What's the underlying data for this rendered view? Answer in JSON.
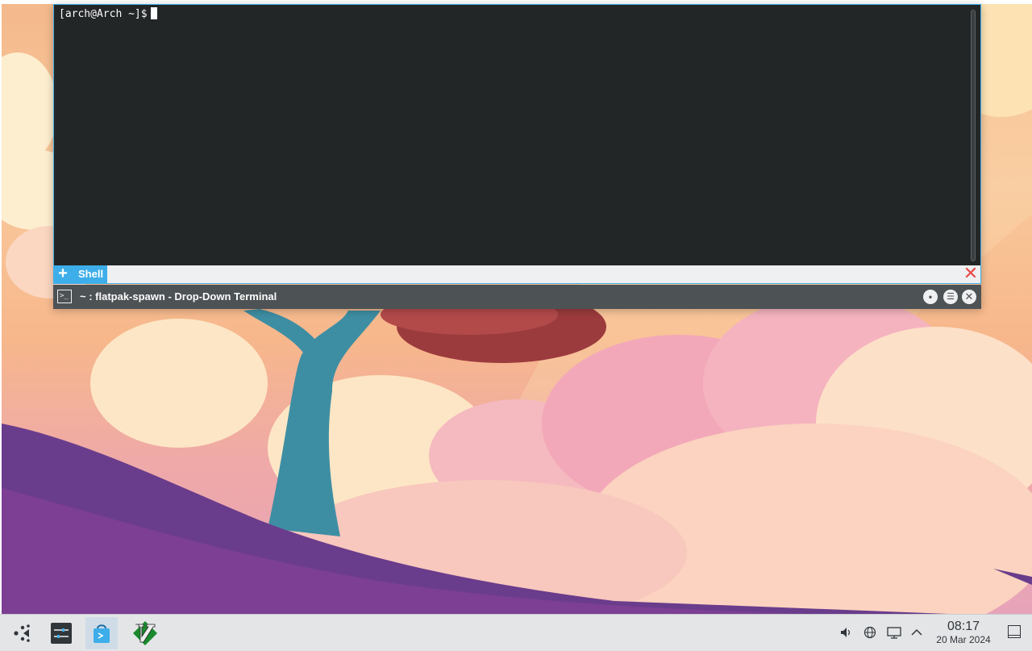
{
  "terminal": {
    "prompt": "[arch@Arch ~]$",
    "tabs": [
      {
        "label": "Shell"
      }
    ],
    "new_tab_glyph": "+",
    "close_glyph": "✕",
    "window_title": "~ : flatpak-spawn - Drop-Down Terminal",
    "title_icon_glyph": ">_"
  },
  "taskbar": {
    "launchers": [
      {
        "name": "application-launcher-icon"
      },
      {
        "name": "system-settings-icon"
      },
      {
        "name": "store-icon",
        "active": true
      },
      {
        "name": "vim-icon"
      }
    ],
    "tray": [
      {
        "name": "volume-icon",
        "glyph": "🔈"
      },
      {
        "name": "network-globe-icon",
        "glyph": "◎"
      },
      {
        "name": "display-icon",
        "glyph": "▭"
      },
      {
        "name": "tray-expand-icon",
        "glyph": "^"
      }
    ],
    "clock": {
      "time": "08:17",
      "date": "20 Mar 2024"
    }
  },
  "colors": {
    "accent": "#3daee9",
    "terminal_bg": "#232627",
    "titlebar_bg": "#4d5255",
    "taskbar_bg": "#e3e5e7"
  }
}
